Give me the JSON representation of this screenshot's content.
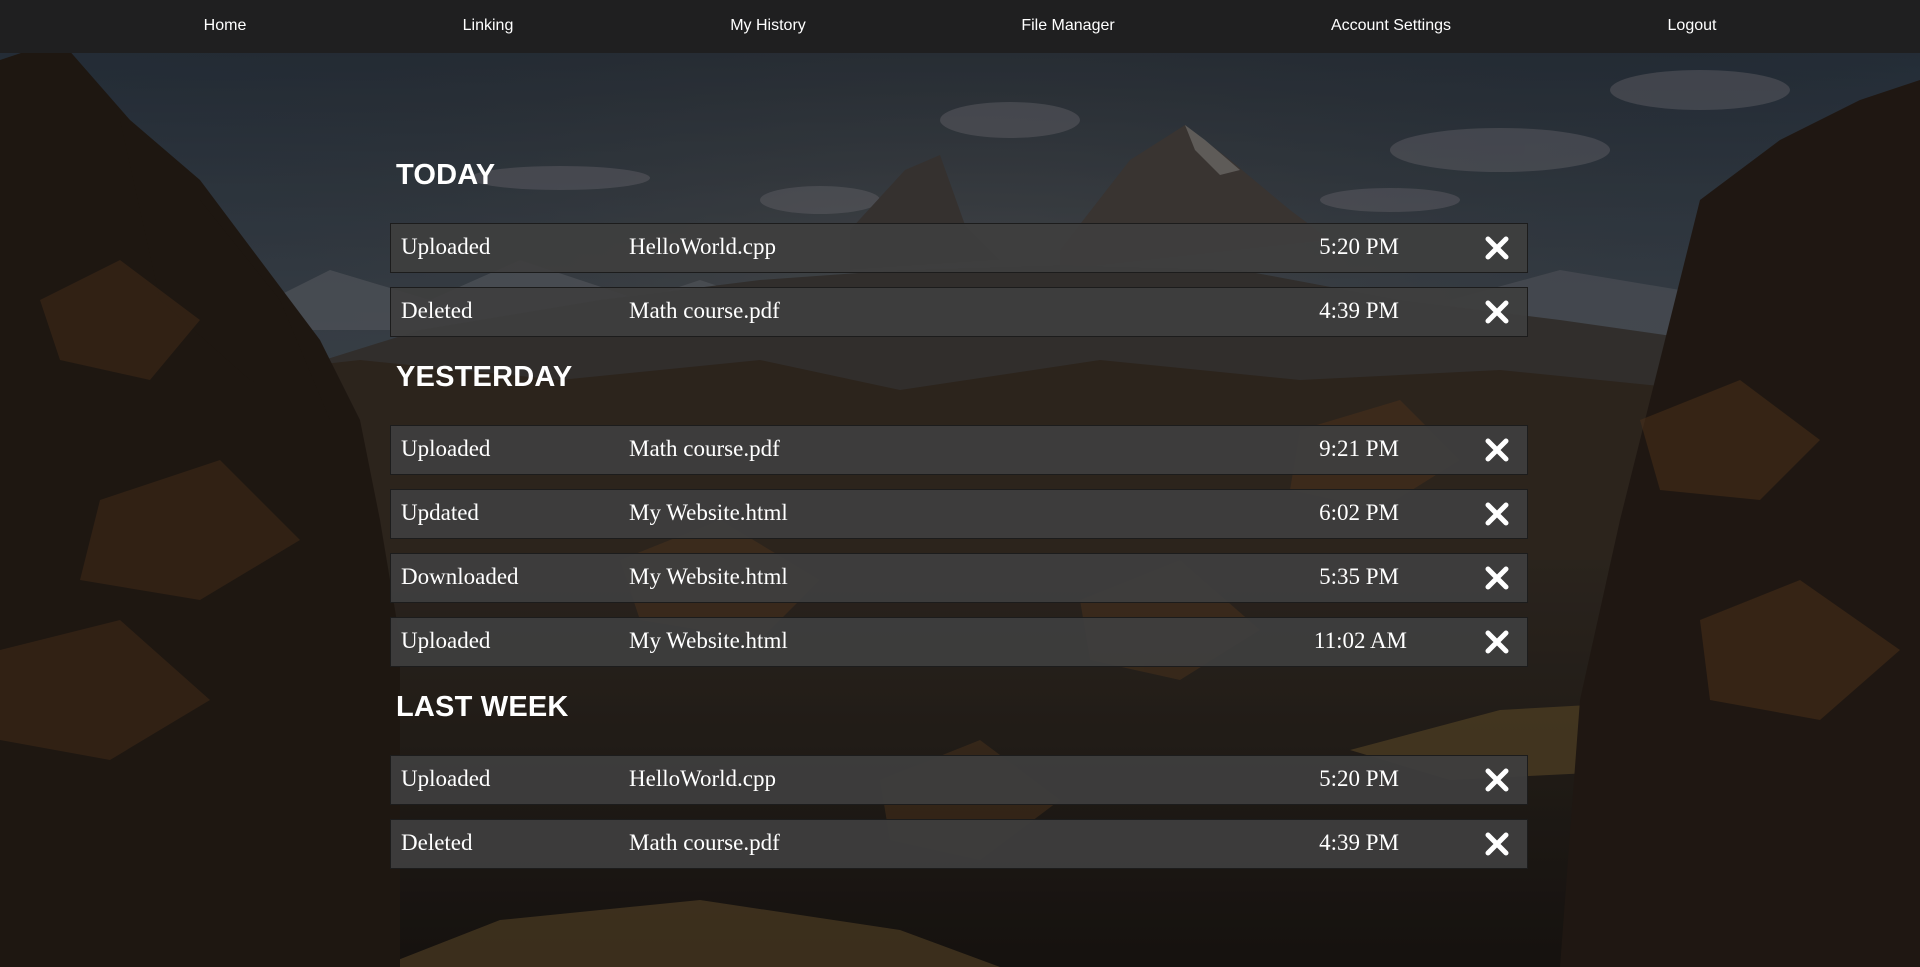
{
  "nav": {
    "items": [
      {
        "label": "Home"
      },
      {
        "label": "Linking"
      },
      {
        "label": "My History"
      },
      {
        "label": "File Manager"
      },
      {
        "label": "Account Settings"
      },
      {
        "label": "Logout"
      }
    ]
  },
  "sections": [
    {
      "title": "TODAY",
      "rows": [
        {
          "action": "Uploaded",
          "file": "HelloWorld.cpp",
          "time": "5:20 PM"
        },
        {
          "action": "Deleted",
          "file": "Math course.pdf",
          "time": "4:39 PM"
        }
      ]
    },
    {
      "title": "YESTERDAY",
      "rows": [
        {
          "action": "Uploaded",
          "file": "Math course.pdf",
          "time": "9:21 PM"
        },
        {
          "action": "Updated",
          "file": "My Website.html",
          "time": "6:02 PM"
        },
        {
          "action": "Downloaded",
          "file": "My Website.html",
          "time": "5:35 PM"
        },
        {
          "action": "Uploaded",
          "file": "My Website.html",
          "time": "11:02 AM"
        }
      ]
    },
    {
      "title": "LAST WEEK",
      "rows": [
        {
          "action": "Uploaded",
          "file": "HelloWorld.cpp",
          "time": "5:20 PM"
        },
        {
          "action": "Deleted",
          "file": "Math course.pdf",
          "time": "4:39 PM"
        }
      ]
    }
  ],
  "icons": {
    "delete": "close-icon"
  },
  "colors": {
    "navbar": "#1f1f20",
    "row_background": "#3e3e3e",
    "text": "#ffffff"
  }
}
